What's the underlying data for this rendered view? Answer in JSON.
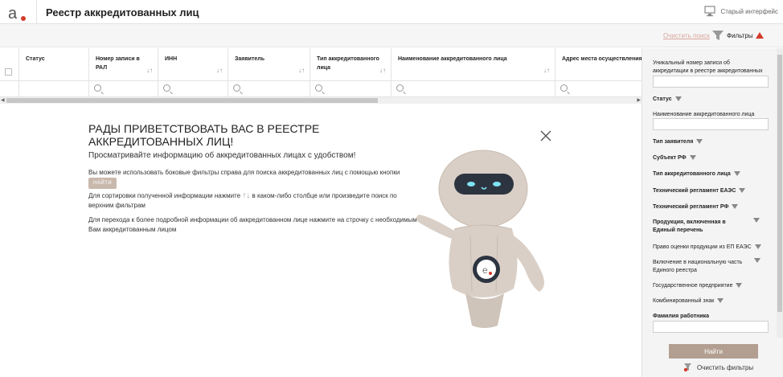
{
  "header": {
    "title": "Реестр аккредитованных лиц",
    "old_interface": "Старый интерфейс"
  },
  "toolbar": {
    "clear_search": "Очистить поиск",
    "filters": "Фильтры"
  },
  "table": {
    "columns": [
      {
        "label": "Статус"
      },
      {
        "label": "Номер записи в РАЛ"
      },
      {
        "label": "ИНН"
      },
      {
        "label": "Заявитель"
      },
      {
        "label": "Тип аккредитованного лица"
      },
      {
        "label": "Наименование аккредитованного лица"
      },
      {
        "label": "Адрес места осуществления де"
      }
    ]
  },
  "welcome": {
    "title": "РАДЫ ПРИВЕТСТВОВАТЬ ВАС В РЕЕСТРЕ АККРЕДИТОВАННЫХ ЛИЦ!",
    "subtitle": "Просматривайте информацию об аккредитованных лицах с удобством!",
    "tip1": "Вы можете использовать боковые фильтры справа для поиска аккредитованных лиц с помощью кнопки",
    "tip1_badge": "НАЙТИ",
    "tip2_a": "Для сортировки полученной информации нажмите",
    "tip2_b": "в каком-либо столбце или произведите поиск по верхним фильтрам",
    "tip3": "Для перехода к более подробной информации об аккредитованном лице нажмите на строчку с необходимым Вам аккредитованным лицом"
  },
  "sidebar": {
    "unique_number": "Уникальный номер записи об аккредитации в реестре аккредитованных лиц",
    "status": "Статус",
    "name": "Наименование аккредитованного лица",
    "applicant_type": "Тип заявителя",
    "subject": "Субъект РФ",
    "accredited_type": "Тип аккредитованного лица",
    "tr_eaeu": "Технический регламент ЕАЭС",
    "tr_rf": "Технический регламент РФ",
    "products": "Продукция, включенная в Единый перечень",
    "right_eval": "Право оценки продукции из ЕП ЕАЭС",
    "national": "Включение в национальную часть Единого реестра",
    "state_enterprise": "Государственное предприятие",
    "combined_mark": "Комбинированный знак",
    "employee": "Фамилия работника",
    "find_button": "Найти",
    "clear_filters": "Очистить фильтры"
  },
  "colors": {
    "accent": "#c0392b",
    "button": "#b29f91"
  }
}
